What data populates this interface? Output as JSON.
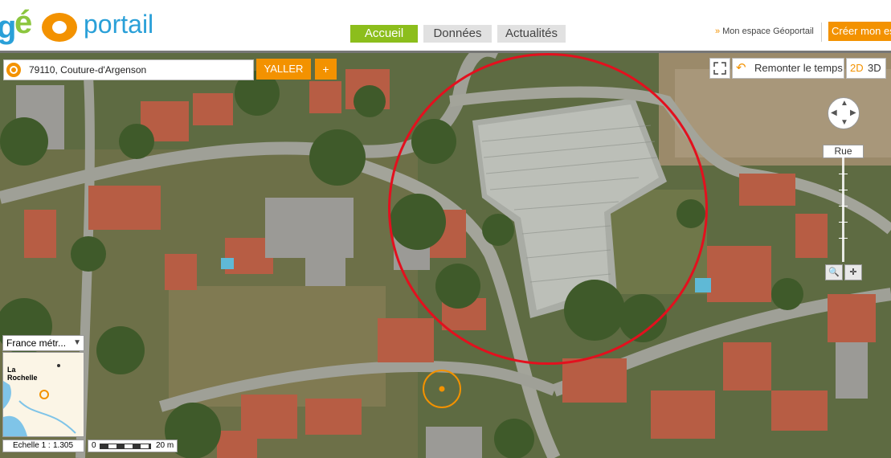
{
  "brand": {
    "prefix": "g",
    "accent": "é",
    "name": "portail"
  },
  "nav": {
    "tabs": [
      {
        "label": "Accueil",
        "active": true
      },
      {
        "label": "Données",
        "active": false
      },
      {
        "label": "Actualités",
        "active": false
      }
    ]
  },
  "header": {
    "espace_label": "Mon espace Géoportail",
    "espace_arrow": "»",
    "creer_label": "Créer mon es"
  },
  "search": {
    "value": "79110, Couture-d'Argenson",
    "go_label": "YALLER",
    "add_label": "+"
  },
  "toolbar": {
    "temps_label": "Remonter le temps",
    "d2_label": "2D",
    "d3_label": "3D"
  },
  "navigation": {
    "rue_label": "Rue"
  },
  "minimap": {
    "projection": "France métr...",
    "city_line1": "La",
    "city_line2": "Rochelle"
  },
  "scale": {
    "echelle_label": "Echelle 1 :",
    "echelle_value": "1.305",
    "zero": "0",
    "distance": "20 m"
  },
  "colors": {
    "accent": "#f39200",
    "active_tab": "#8cbe1c",
    "brand_blue": "#2aa0d8",
    "annotation": "#e3101e"
  }
}
